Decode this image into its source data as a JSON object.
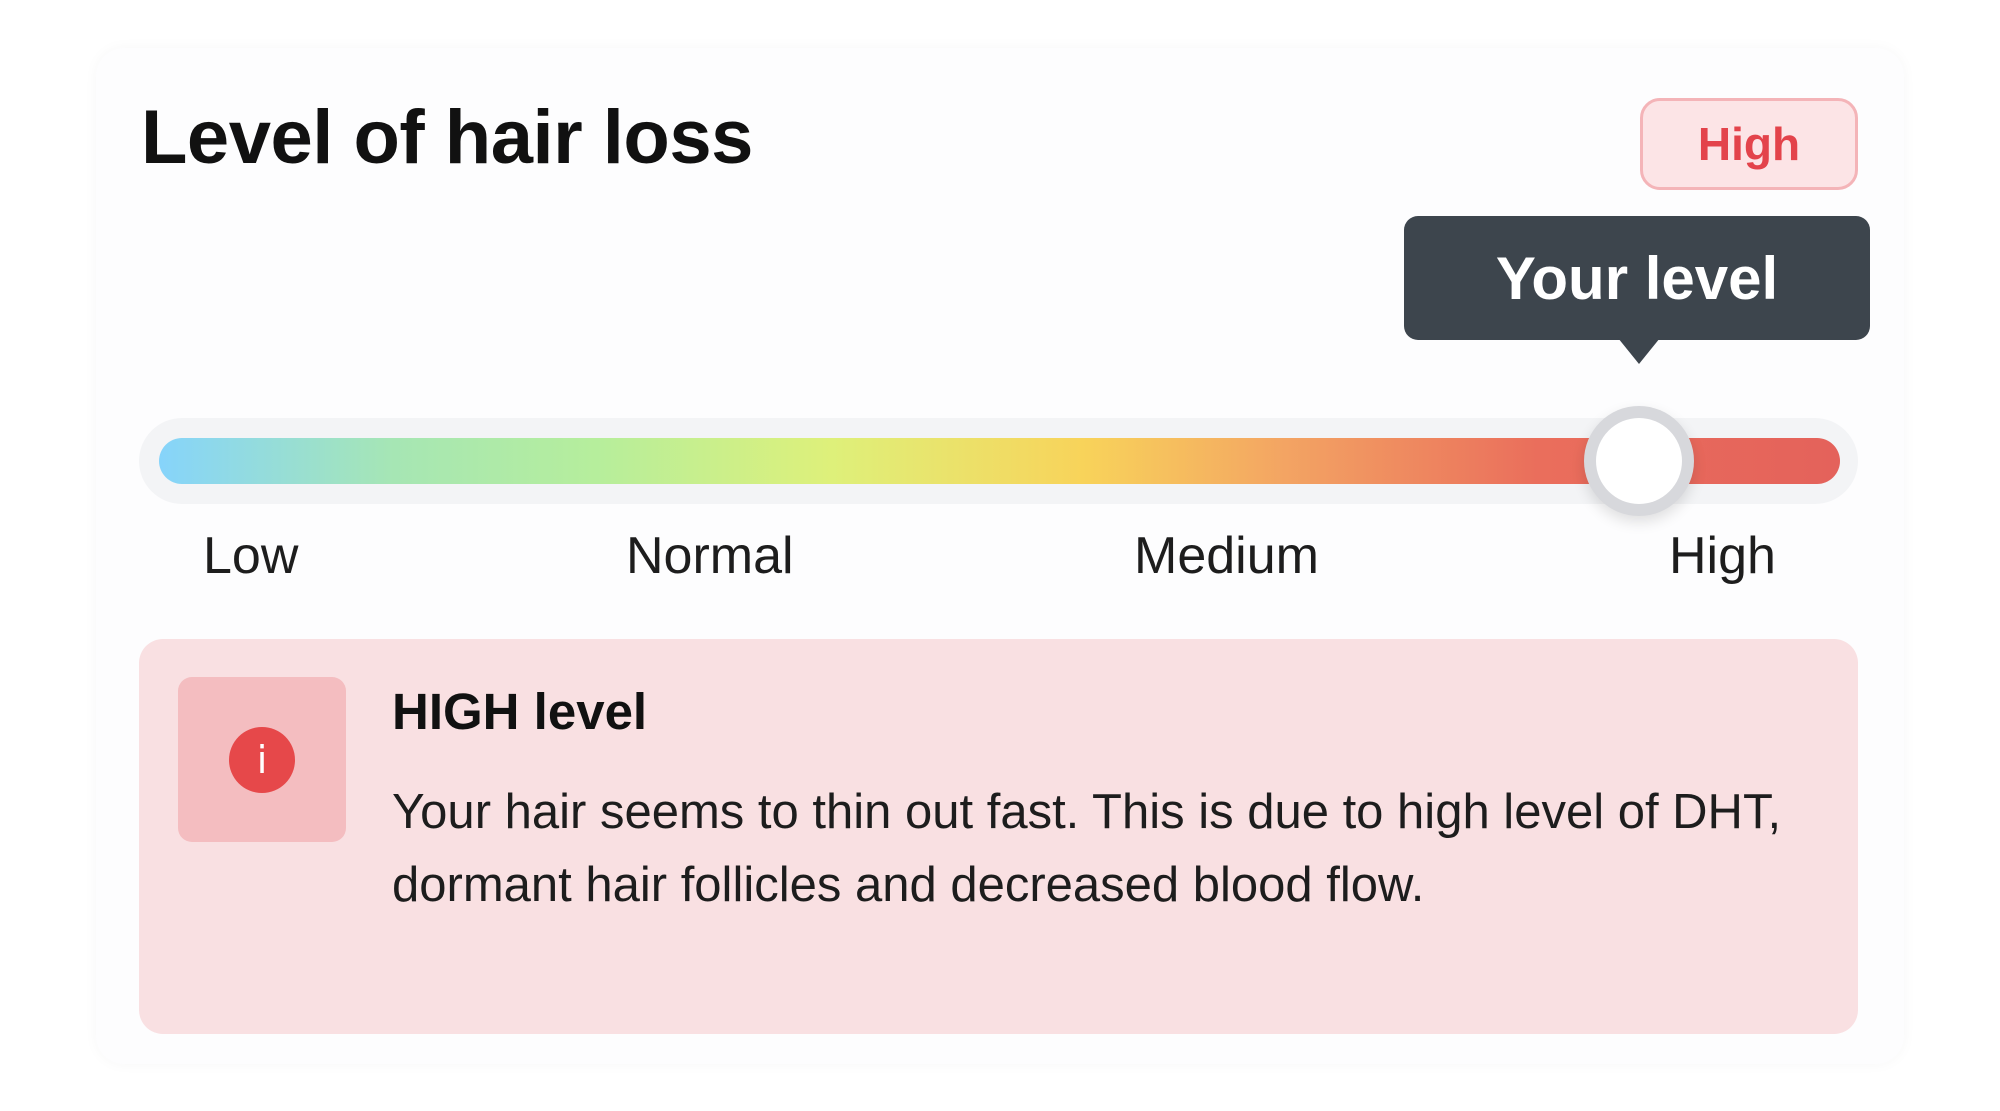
{
  "card": {
    "title": "Level of hair loss",
    "badge": "High"
  },
  "slider": {
    "tooltip": "Your level",
    "labels": [
      "Low",
      "Normal",
      "Medium",
      "High"
    ],
    "current_level": "High",
    "value_fraction": 0.87,
    "gradient_colors": [
      "#86d4fb",
      "#b6ee9c",
      "#f8d35a",
      "#f3a463",
      "#e4625b"
    ]
  },
  "info": {
    "icon": "info-icon",
    "icon_glyph": "i",
    "title": "HIGH level",
    "text": "Your hair seems to thin out fast. This is due to high level of DHT, dormant hair follicles and decreased blood flow."
  },
  "colors": {
    "accent_red": "#e3434b",
    "tooltip_bg": "#3d454d",
    "info_bg": "#f9e0e2"
  }
}
